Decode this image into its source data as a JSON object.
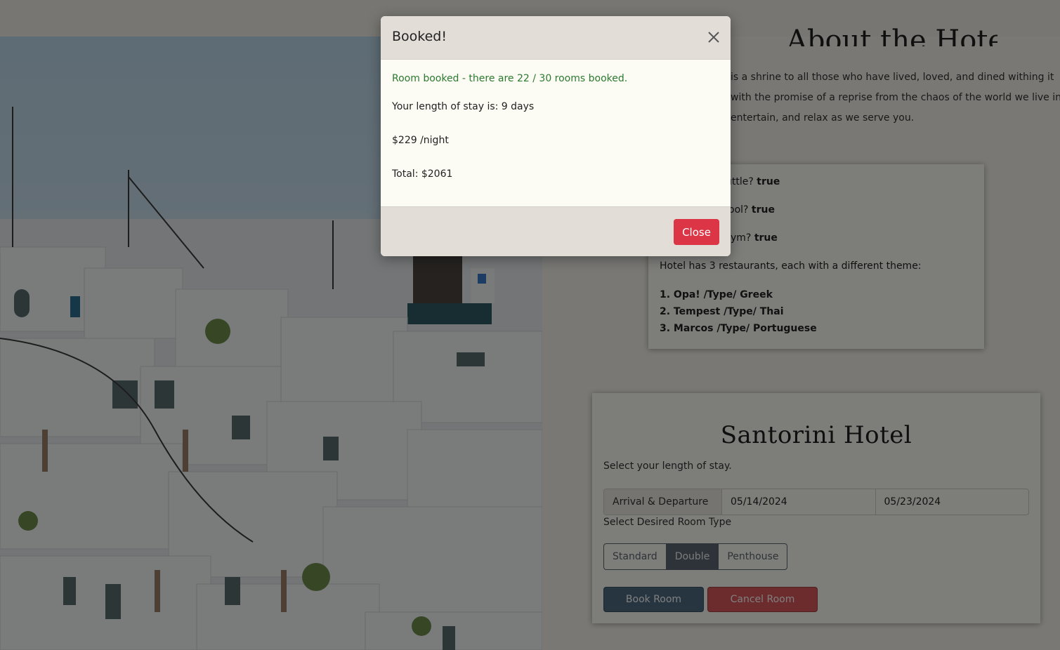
{
  "about": {
    "title": "About the Hotel",
    "paragraph_lines": [
      "is a shrine to all those who have lived, loved, and dined withing it",
      "with the promise of a reprise from the chaos of the world we live in",
      "entertain, and relax as we serve you."
    ]
  },
  "amenities": {
    "shuttle_label": "uttle?",
    "shuttle_value": "true",
    "pool_label": "ool?",
    "pool_value": "true",
    "gym_label": "ym?",
    "gym_value": "true",
    "restaurants_intro": "Hotel has 3 restaurants, each with a different theme:",
    "restaurants": [
      "1. Opa! /Type/ Greek",
      "2. Tempest /Type/ Thai",
      "3. Marcos /Type/ Portuguese"
    ]
  },
  "booking": {
    "hotel_name": "Santorini Hotel",
    "stay_label": "Select your length of stay.",
    "date_addon": "Arrival & Departure",
    "arrival": "05/14/2024",
    "departure": "05/23/2024",
    "room_type_label": "Select Desired Room Type",
    "room_types": [
      "Standard",
      "Double",
      "Penthouse"
    ],
    "selected_room_type": "Double",
    "book_label": "Book Room",
    "cancel_label": "Cancel Room"
  },
  "modal": {
    "title": "Booked!",
    "success_message": "Room booked - there are 22 / 30 rooms booked.",
    "stay_message": "Your length of stay is: 9 days",
    "price_message": "$229 /night",
    "total_message": "Total: $2061",
    "close_label": "Close",
    "close_icon": "close-x-icon"
  },
  "colors": {
    "success_green": "#2a7a2f",
    "danger_red": "#dc3545",
    "slate_button": "#4c6a80",
    "modal_header": "#e2ddd7",
    "backdrop": "rgba(0,0,0,0.5)"
  }
}
